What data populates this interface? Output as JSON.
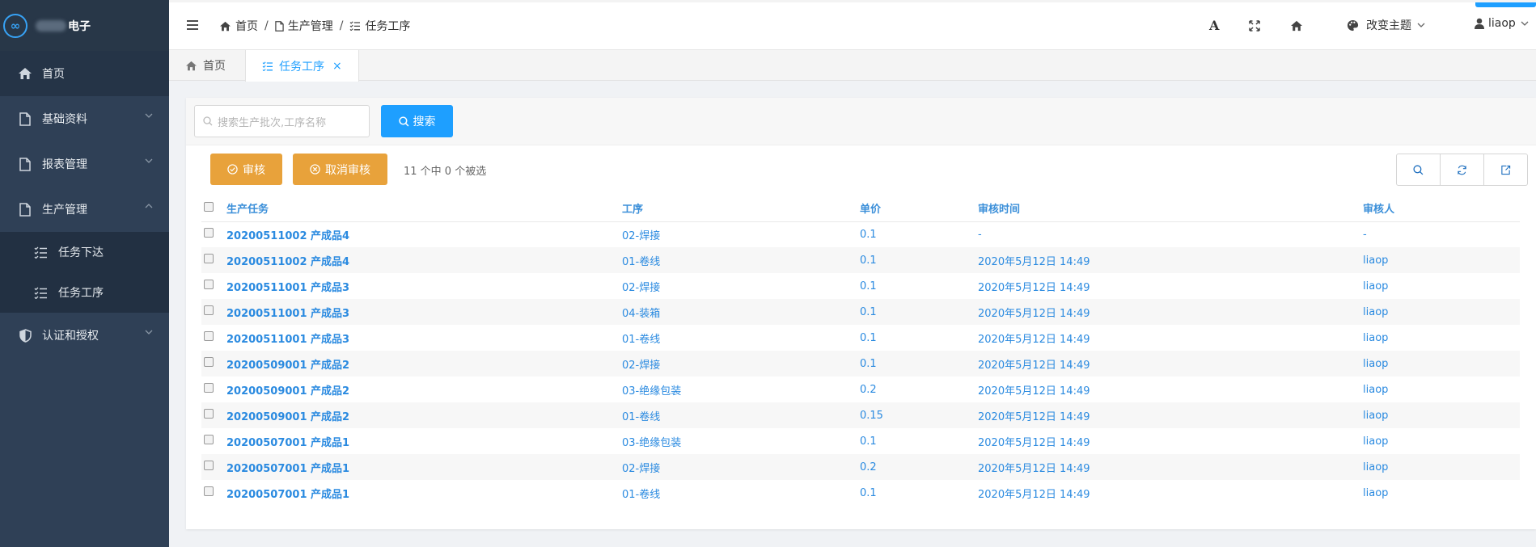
{
  "app": {
    "logo_text": "电子"
  },
  "sidebar": {
    "items": [
      {
        "label": "首页",
        "icon": "home-icon"
      },
      {
        "label": "基础资料",
        "icon": "file-icon"
      },
      {
        "label": "报表管理",
        "icon": "file-icon"
      },
      {
        "label": "生产管理",
        "icon": "file-icon"
      },
      {
        "label": "认证和授权",
        "icon": "shield-icon"
      }
    ],
    "sub_items": [
      {
        "label": "任务下达",
        "icon": "list-icon"
      },
      {
        "label": "任务工序",
        "icon": "list-icon"
      }
    ]
  },
  "header": {
    "breadcrumb": [
      "首页",
      "生产管理",
      "任务工序"
    ],
    "breadcrumb_sep": "/",
    "theme_label": "改变主题",
    "user_name": "liaop",
    "font_icon_glyph": "A"
  },
  "tabs": [
    {
      "label": "首页",
      "icon": "home-icon"
    },
    {
      "label": "任务工序",
      "icon": "list-icon",
      "close": "×"
    }
  ],
  "search": {
    "placeholder": "搜索生产批次,工序名称",
    "button_label": "搜索"
  },
  "toolbar": {
    "approve_label": "审核",
    "cancel_approve_label": "取消审核",
    "selection_info": "11 个中 0 个被选"
  },
  "table": {
    "columns": [
      "生产任务",
      "工序",
      "单价",
      "审核时间",
      "审核人"
    ],
    "rows": [
      {
        "task": "20200511002 产成品4",
        "process": "02-焊接",
        "price": "0.1",
        "time": "-",
        "auditor": "-"
      },
      {
        "task": "20200511002 产成品4",
        "process": "01-卷线",
        "price": "0.1",
        "time": "2020年5月12日 14:49",
        "auditor": "liaop"
      },
      {
        "task": "20200511001 产成品3",
        "process": "02-焊接",
        "price": "0.1",
        "time": "2020年5月12日 14:49",
        "auditor": "liaop"
      },
      {
        "task": "20200511001 产成品3",
        "process": "04-装箱",
        "price": "0.1",
        "time": "2020年5月12日 14:49",
        "auditor": "liaop"
      },
      {
        "task": "20200511001 产成品3",
        "process": "01-卷线",
        "price": "0.1",
        "time": "2020年5月12日 14:49",
        "auditor": "liaop"
      },
      {
        "task": "20200509001 产成品2",
        "process": "02-焊接",
        "price": "0.1",
        "time": "2020年5月12日 14:49",
        "auditor": "liaop"
      },
      {
        "task": "20200509001 产成品2",
        "process": "03-绝缘包装",
        "price": "0.2",
        "time": "2020年5月12日 14:49",
        "auditor": "liaop"
      },
      {
        "task": "20200509001 产成品2",
        "process": "01-卷线",
        "price": "0.15",
        "time": "2020年5月12日 14:49",
        "auditor": "liaop"
      },
      {
        "task": "20200507001 产成品1",
        "process": "03-绝缘包装",
        "price": "0.1",
        "time": "2020年5月12日 14:49",
        "auditor": "liaop"
      },
      {
        "task": "20200507001 产成品1",
        "process": "02-焊接",
        "price": "0.2",
        "time": "2020年5月12日 14:49",
        "auditor": "liaop"
      },
      {
        "task": "20200507001 产成品1",
        "process": "01-卷线",
        "price": "0.1",
        "time": "2020年5月12日 14:49",
        "auditor": "liaop"
      }
    ]
  },
  "colors": {
    "sidebar_bg": "#2f4056",
    "accent": "#1e9fff",
    "warning": "#e8a23b",
    "link": "#2a8ae0"
  }
}
